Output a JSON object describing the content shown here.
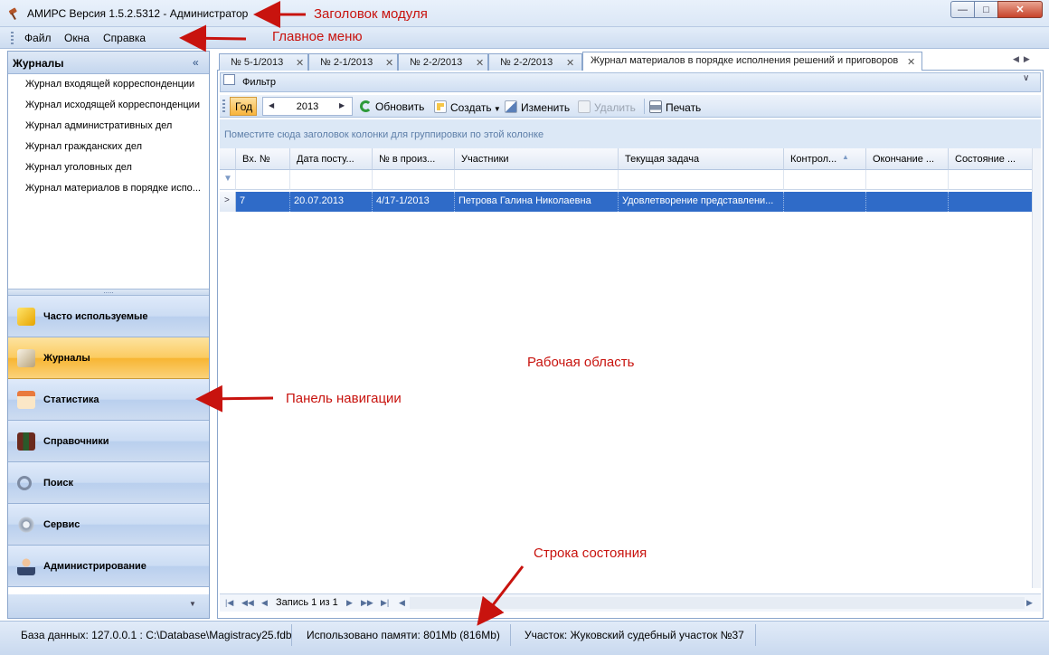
{
  "window": {
    "title": "АМИРС Версия 1.5.2.5312  - Администратор"
  },
  "menu": {
    "items": [
      "Файл",
      "Окна",
      "Справка"
    ]
  },
  "left_panel": {
    "header": "Журналы",
    "collapse_glyph": "«",
    "journals": [
      "Журнал входящей корреспонденции",
      "Журнал исходящей корреспонденции",
      "Журнал административных дел",
      "Журнал гражданских дел",
      "Журнал уголовных дел",
      "Журнал материалов в порядке испо..."
    ],
    "nav": [
      {
        "label": "Часто используемые",
        "icon": "lightning-icon"
      },
      {
        "label": "Журналы",
        "icon": "book-icon",
        "active": true
      },
      {
        "label": "Статистика",
        "icon": "calendar-icon"
      },
      {
        "label": "Справочники",
        "icon": "books-icon"
      },
      {
        "label": "Поиск",
        "icon": "magnifier-icon"
      },
      {
        "label": "Сервис",
        "icon": "gears-icon"
      },
      {
        "label": "Администрирование",
        "icon": "admin-user-icon"
      }
    ]
  },
  "tabs": [
    {
      "label": "№ 5-1/2013"
    },
    {
      "label": "№ 2-1/2013"
    },
    {
      "label": "№ 2-2/2013"
    },
    {
      "label": "№ 2-2/2013"
    },
    {
      "label": "Журнал материалов в порядке исполнения решений и приговоров",
      "active": true
    }
  ],
  "filter": {
    "label": "Фильтр"
  },
  "toolbar": {
    "year_label": "Год",
    "year_value": "2013",
    "refresh": "Обновить",
    "create": "Создать",
    "edit": "Изменить",
    "delete": "Удалить",
    "print": "Печать"
  },
  "grid": {
    "group_hint": "Поместите сюда заголовок колонки для группировки по этой колонке",
    "columns": [
      "Вх. №",
      "Дата посту...",
      "№ в произ...",
      "Участники",
      "Текущая задача",
      "Контрол...",
      "Окончание ...",
      "Состояние ..."
    ],
    "rows": [
      [
        "7",
        "20.07.2013",
        "4/17-1/2013",
        "Петрова Галина Николаевна",
        "Удовлетворение представлени...",
        "",
        "",
        ""
      ]
    ]
  },
  "pager": {
    "text": "Запись 1 из 1"
  },
  "status": {
    "db": "База данных: 127.0.0.1 : C:\\Database\\Magistracy25.fdb",
    "memory": "Использовано памяти: 801Mb (816Mb)",
    "district": "Участок: Жуковский судебный участок №37"
  },
  "annotations": {
    "module_title": "Заголовок модуля",
    "main_menu": "Главное меню",
    "work_area": "Рабочая область",
    "nav_panel": "Панель навигации",
    "status_bar": "Строка состояния"
  },
  "colors": {
    "accent": "#2f6bc8",
    "annotation": "#c8130e",
    "active_nav": "#f8b43c"
  }
}
